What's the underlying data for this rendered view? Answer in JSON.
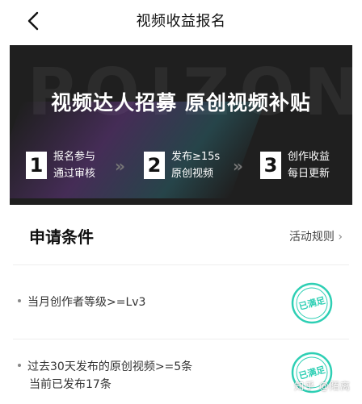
{
  "header": {
    "title": "视频收益报名",
    "back_icon": "chevron-left-icon"
  },
  "banner": {
    "bg_text": "POIZON",
    "headline": "视频达人招募 原创视频补贴",
    "steps": [
      {
        "num": "1",
        "line1": "报名参与",
        "line2": "通过审核"
      },
      {
        "num": "2",
        "line1": "发布≥15s",
        "line2": "原创视频"
      },
      {
        "num": "3",
        "line1": "创作收益",
        "line2": "每日更新"
      }
    ],
    "arrow": "»"
  },
  "conditions": {
    "title": "申请条件",
    "rules_link": "活动规则",
    "rules_chevron": "›",
    "items": [
      {
        "text": "当月创作者等级>=Lv3",
        "sub": "",
        "status": "已满足"
      },
      {
        "text": "过去30天发布的原创视频>=5条",
        "sub": "当前已发布17条",
        "status": "已满足"
      }
    ]
  },
  "watermark": "知乎 @陌离",
  "colors": {
    "stamp": "#2ecfb4",
    "banner_bg": "#1f1f1f"
  }
}
